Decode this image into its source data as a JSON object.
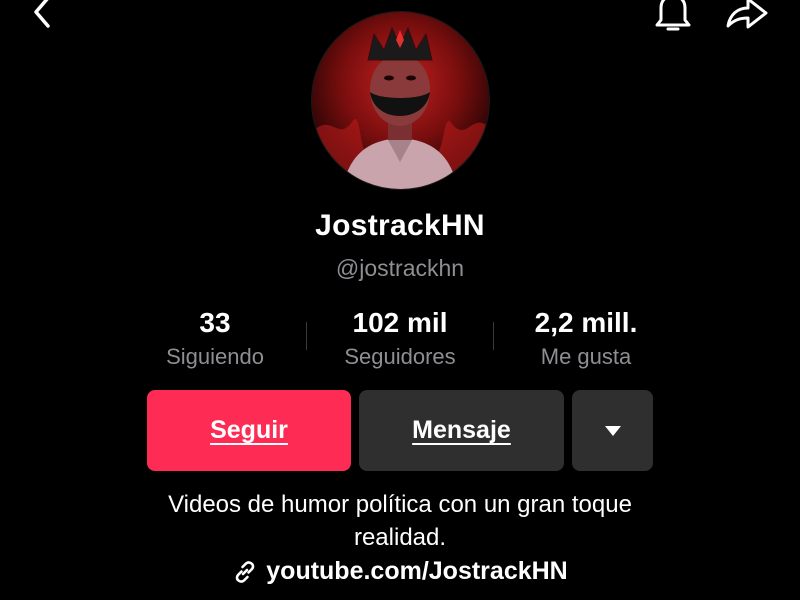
{
  "icons": {
    "back": "chevron-left-icon",
    "notifications": "bell-icon",
    "share": "share-arrow-icon",
    "dropdown": "caret-down-icon",
    "link": "link-icon"
  },
  "profile": {
    "display_name": "JostrackHN",
    "username": "@jostrackhn"
  },
  "stats": {
    "following": {
      "value": "33",
      "label": "Siguiendo"
    },
    "followers": {
      "value": "102 mil",
      "label": "Seguidores"
    },
    "likes": {
      "value": "2,2 mill.",
      "label": "Me gusta"
    }
  },
  "actions": {
    "follow_label": "Seguir",
    "message_label": "Mensaje"
  },
  "bio": {
    "line1": "Videos de humor política con un gran toque",
    "line2": "realidad."
  },
  "link": {
    "text": "youtube.com/JostrackHN"
  },
  "colors": {
    "background": "#000000",
    "follow_button": "#fe2c55",
    "secondary_button": "#2f2f2f",
    "muted_text": "#8e8e93"
  }
}
